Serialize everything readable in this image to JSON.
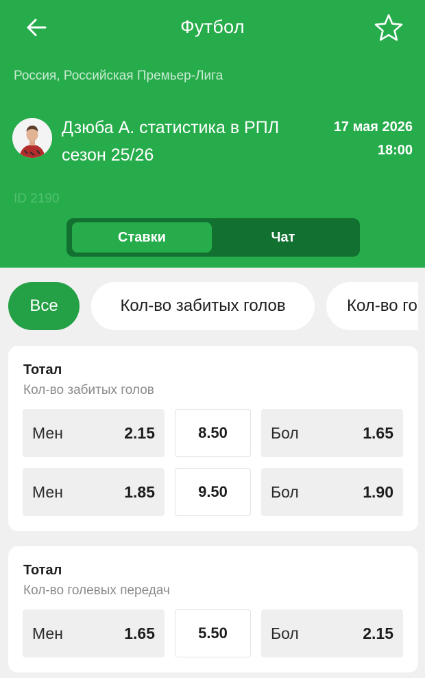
{
  "header": {
    "title": "Футбол",
    "league": "Россия, Российская Премьер-Лига",
    "event_name_line1": "Дзюба А. статистика в РПЛ",
    "event_name_line2": "сезон 25/26",
    "date": "17 мая 2026",
    "time": "18:00",
    "event_id": "ID 2190",
    "back_icon": "arrow-left-icon",
    "favorite_icon": "star-outline-icon"
  },
  "tabs": [
    {
      "label": "Ставки",
      "active": true
    },
    {
      "label": "Чат",
      "active": false
    }
  ],
  "filters": [
    {
      "label": "Все",
      "active": true
    },
    {
      "label": "Кол-во забитых голов",
      "active": false
    },
    {
      "label": "Кол-во го",
      "active": false
    }
  ],
  "markets": [
    {
      "title": "Тотал",
      "subtitle": "Кол-во забитых голов",
      "rows": [
        {
          "under_label": "Мен",
          "under_odds": "2.15",
          "line": "8.50",
          "over_label": "Бол",
          "over_odds": "1.65"
        },
        {
          "under_label": "Мен",
          "under_odds": "1.85",
          "line": "9.50",
          "over_label": "Бол",
          "over_odds": "1.90"
        }
      ]
    },
    {
      "title": "Тотал",
      "subtitle": "Кол-во голевых передач",
      "rows": [
        {
          "under_label": "Мен",
          "under_odds": "1.65",
          "line": "5.50",
          "over_label": "Бол",
          "over_odds": "2.15"
        }
      ]
    }
  ],
  "colors": {
    "brand_green": "#27ac4b",
    "segment_dark": "#127031",
    "chip_active": "#24a046"
  }
}
